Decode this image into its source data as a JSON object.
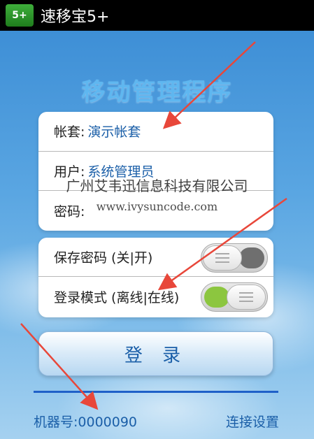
{
  "titlebar": {
    "app_icon_text": "5+",
    "app_title": "速移宝5+"
  },
  "heading": "移动管理程序",
  "fields": [
    {
      "label": "帐套:",
      "value": "演示帐套"
    },
    {
      "label": "用户:",
      "value": "系统管理员"
    },
    {
      "label": "密码:",
      "value": ""
    }
  ],
  "toggles": [
    {
      "label": "保存密码 (关|开)",
      "state": "off"
    },
    {
      "label": "登录模式 (离线|在线)",
      "state": "on"
    }
  ],
  "login_button": "登 录",
  "footer": {
    "machine_label": "机器号:0000090",
    "settings_link": "连接设置"
  },
  "watermark": {
    "company": "广州艾韦迅信息科技有限公司",
    "url": "www.ivysuncode.com"
  },
  "colors": {
    "accent": "#1b5fa8",
    "arrow": "#e8473a",
    "toggle_on": "#8cc63f",
    "toggle_off": "#6f6f6f"
  }
}
